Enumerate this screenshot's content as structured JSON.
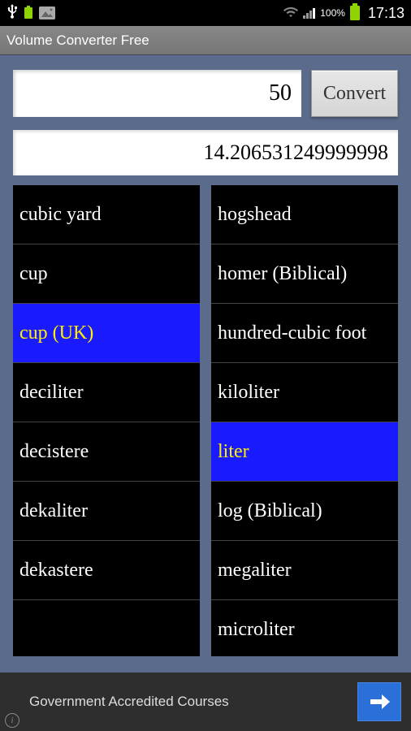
{
  "status": {
    "battery_pct": "100%",
    "time": "17:13"
  },
  "title": "Volume Converter Free",
  "input_value": "50",
  "convert_label": "Convert",
  "result_value": "14.206531249999998",
  "left_list": [
    {
      "label": "cubic yard",
      "selected": false
    },
    {
      "label": "cup",
      "selected": false
    },
    {
      "label": "cup (UK)",
      "selected": true
    },
    {
      "label": "deciliter",
      "selected": false
    },
    {
      "label": "decistere",
      "selected": false
    },
    {
      "label": "dekaliter",
      "selected": false
    },
    {
      "label": "dekastere",
      "selected": false
    }
  ],
  "right_list": [
    {
      "label": "hogshead",
      "selected": false
    },
    {
      "label": "homer (Biblical)",
      "selected": false
    },
    {
      "label": "hundred-cubic foot",
      "selected": false
    },
    {
      "label": "kiloliter",
      "selected": false
    },
    {
      "label": "liter",
      "selected": true
    },
    {
      "label": "log (Biblical)",
      "selected": false
    },
    {
      "label": "megaliter",
      "selected": false
    },
    {
      "label": "microliter",
      "selected": false
    }
  ],
  "ad": {
    "text": "Government Accredited Courses"
  }
}
